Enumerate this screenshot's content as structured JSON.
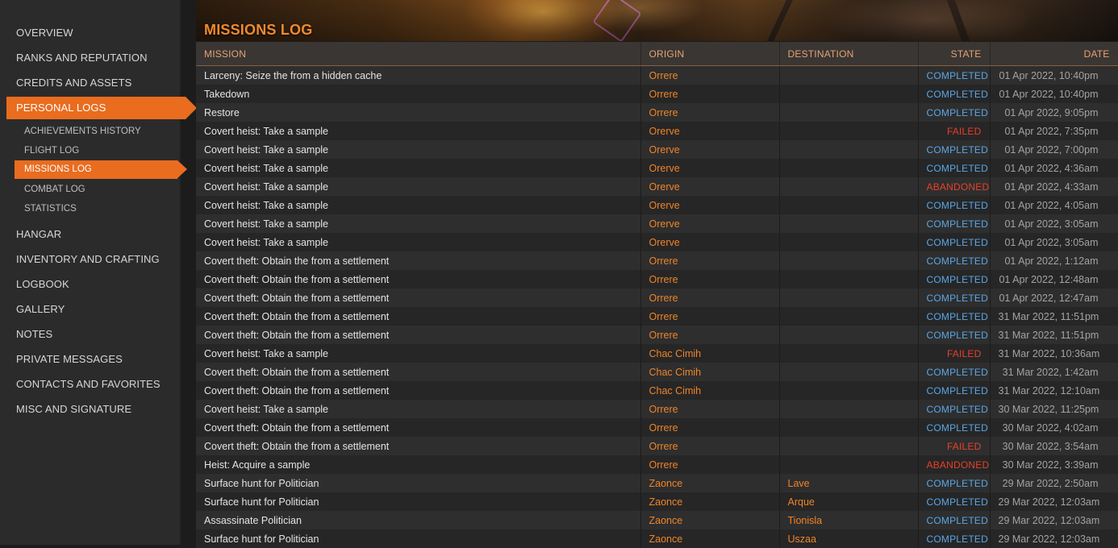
{
  "sidebar": {
    "items_top": [
      {
        "label": "OVERVIEW"
      },
      {
        "label": "RANKS AND REPUTATION"
      },
      {
        "label": "CREDITS AND ASSETS"
      }
    ],
    "active_item": {
      "label": "PERSONAL LOGS"
    },
    "sub_items": [
      {
        "label": "ACHIEVEMENTS HISTORY"
      },
      {
        "label": "FLIGHT LOG"
      },
      {
        "label": "MISSIONS LOG"
      },
      {
        "label": "COMBAT LOG"
      },
      {
        "label": "STATISTICS"
      }
    ],
    "items_bottom": [
      {
        "label": "HANGAR"
      },
      {
        "label": "INVENTORY AND CRAFTING"
      },
      {
        "label": "LOGBOOK"
      },
      {
        "label": "GALLERY"
      },
      {
        "label": "NOTES"
      },
      {
        "label": "PRIVATE MESSAGES"
      },
      {
        "label": "CONTACTS AND FAVORITES"
      },
      {
        "label": "MISC AND SIGNATURE"
      }
    ]
  },
  "page": {
    "title": "MISSIONS LOG"
  },
  "table": {
    "headers": {
      "mission": "MISSION",
      "origin": "ORIGIN",
      "destination": "DESTINATION",
      "state": "STATE",
      "date": "DATE"
    },
    "rows": [
      {
        "mission": "Larceny: Seize the from a hidden cache",
        "origin": "Orrere",
        "destination": "",
        "state": "COMPLETED",
        "date": "01 Apr 2022, 10:40pm"
      },
      {
        "mission": "Takedown",
        "origin": "Orrere",
        "destination": "",
        "state": "COMPLETED",
        "date": "01 Apr 2022, 10:40pm"
      },
      {
        "mission": "Restore",
        "origin": "Orrere",
        "destination": "",
        "state": "COMPLETED",
        "date": "01 Apr 2022, 9:05pm"
      },
      {
        "mission": "Covert heist: Take a sample",
        "origin": "Orerve",
        "destination": "",
        "state": "FAILED",
        "date": "01 Apr 2022, 7:35pm"
      },
      {
        "mission": "Covert heist: Take a sample",
        "origin": "Orerve",
        "destination": "",
        "state": "COMPLETED",
        "date": "01 Apr 2022, 7:00pm"
      },
      {
        "mission": "Covert heist: Take a sample",
        "origin": "Orerve",
        "destination": "",
        "state": "COMPLETED",
        "date": "01 Apr 2022, 4:36am"
      },
      {
        "mission": "Covert heist: Take a sample",
        "origin": "Orerve",
        "destination": "",
        "state": "ABANDONED",
        "date": "01 Apr 2022, 4:33am"
      },
      {
        "mission": "Covert heist: Take a sample",
        "origin": "Orerve",
        "destination": "",
        "state": "COMPLETED",
        "date": "01 Apr 2022, 4:05am"
      },
      {
        "mission": "Covert heist: Take a sample",
        "origin": "Orerve",
        "destination": "",
        "state": "COMPLETED",
        "date": "01 Apr 2022, 3:05am"
      },
      {
        "mission": "Covert heist: Take a sample",
        "origin": "Orerve",
        "destination": "",
        "state": "COMPLETED",
        "date": "01 Apr 2022, 3:05am"
      },
      {
        "mission": "Covert theft: Obtain the from a settlement",
        "origin": "Orrere",
        "destination": "",
        "state": "COMPLETED",
        "date": "01 Apr 2022, 1:12am"
      },
      {
        "mission": "Covert theft: Obtain the from a settlement",
        "origin": "Orrere",
        "destination": "",
        "state": "COMPLETED",
        "date": "01 Apr 2022, 12:48am"
      },
      {
        "mission": "Covert theft: Obtain the from a settlement",
        "origin": "Orrere",
        "destination": "",
        "state": "COMPLETED",
        "date": "01 Apr 2022, 12:47am"
      },
      {
        "mission": "Covert theft: Obtain the from a settlement",
        "origin": "Orrere",
        "destination": "",
        "state": "COMPLETED",
        "date": "31 Mar 2022, 11:51pm"
      },
      {
        "mission": "Covert theft: Obtain the from a settlement",
        "origin": "Orrere",
        "destination": "",
        "state": "COMPLETED",
        "date": "31 Mar 2022, 11:51pm"
      },
      {
        "mission": "Covert heist: Take a sample",
        "origin": "Chac Cimih",
        "destination": "",
        "state": "FAILED",
        "date": "31 Mar 2022, 10:36am"
      },
      {
        "mission": "Covert theft: Obtain the from a settlement",
        "origin": "Chac Cimih",
        "destination": "",
        "state": "COMPLETED",
        "date": "31 Mar 2022, 1:42am"
      },
      {
        "mission": "Covert theft: Obtain the from a settlement",
        "origin": "Chac Cimih",
        "destination": "",
        "state": "COMPLETED",
        "date": "31 Mar 2022, 12:10am"
      },
      {
        "mission": "Covert heist: Take a sample",
        "origin": "Orrere",
        "destination": "",
        "state": "COMPLETED",
        "date": "30 Mar 2022, 11:25pm"
      },
      {
        "mission": "Covert theft: Obtain the from a settlement",
        "origin": "Orrere",
        "destination": "",
        "state": "COMPLETED",
        "date": "30 Mar 2022, 4:02am"
      },
      {
        "mission": "Covert theft: Obtain the from a settlement",
        "origin": "Orrere",
        "destination": "",
        "state": "FAILED",
        "date": "30 Mar 2022, 3:54am"
      },
      {
        "mission": "Heist: Acquire a sample",
        "origin": "Orrere",
        "destination": "",
        "state": "ABANDONED",
        "date": "30 Mar 2022, 3:39am"
      },
      {
        "mission": "Surface hunt for Politician",
        "origin": "Zaonce",
        "destination": "Lave",
        "state": "COMPLETED",
        "date": "29 Mar 2022, 2:50am"
      },
      {
        "mission": "Surface hunt for Politician",
        "origin": "Zaonce",
        "destination": "Arque",
        "state": "COMPLETED",
        "date": "29 Mar 2022, 12:03am"
      },
      {
        "mission": "Assassinate Politician",
        "origin": "Zaonce",
        "destination": "Tionisla",
        "state": "COMPLETED",
        "date": "29 Mar 2022, 12:03am"
      },
      {
        "mission": "Surface hunt for Politician",
        "origin": "Zaonce",
        "destination": "Uszaa",
        "state": "COMPLETED",
        "date": "29 Mar 2022, 12:03am"
      }
    ]
  }
}
